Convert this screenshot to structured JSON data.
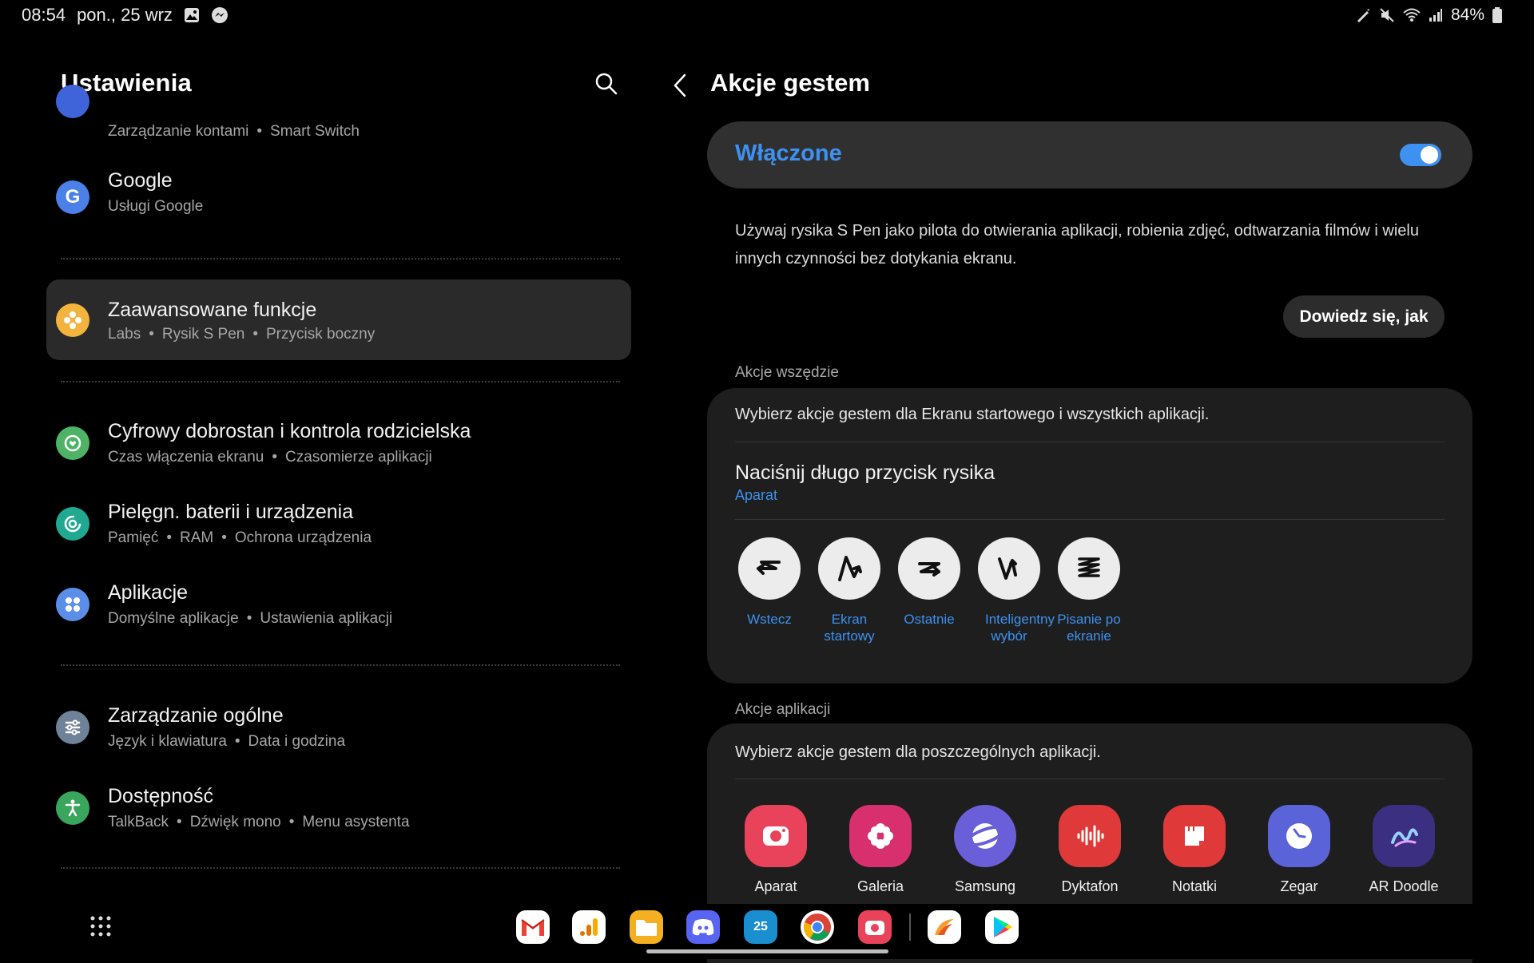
{
  "status_bar": {
    "time": "08:54",
    "date": "pon., 25 wrz",
    "battery": "84%",
    "left_icons": [
      "image-icon",
      "messenger-icon"
    ],
    "right_icons": [
      "spen-icon",
      "mute-icon",
      "wifi-icon",
      "signal-icon",
      "battery-icon"
    ]
  },
  "left_pane": {
    "title": "Ustawienia",
    "items": [
      {
        "title": "",
        "subtitle": [
          "Zarządzanie kontami",
          "Smart Switch"
        ],
        "icon": "accounts-icon",
        "color": "#3f63d9"
      },
      {
        "title": "Google",
        "subtitle": [
          "Usługi Google"
        ],
        "icon": "google-icon",
        "color": "#4a80e8"
      },
      {
        "title": "Zaawansowane funkcje",
        "subtitle": [
          "Labs",
          "Rysik S Pen",
          "Przycisk boczny"
        ],
        "icon": "advanced-features-icon",
        "color": "#f2b43c",
        "selected": true
      },
      {
        "title": "Cyfrowy dobrostan i kontrola rodzicielska",
        "subtitle": [
          "Czas włączenia ekranu",
          "Czasomierze aplikacji"
        ],
        "icon": "wellbeing-icon",
        "color": "#4fb365"
      },
      {
        "title": "Pielęgn. baterii i urządzenia",
        "subtitle": [
          "Pamięć",
          "RAM",
          "Ochrona urządzenia"
        ],
        "icon": "device-care-icon",
        "color": "#21a891"
      },
      {
        "title": "Aplikacje",
        "subtitle": [
          "Domyślne aplikacje",
          "Ustawienia aplikacji"
        ],
        "icon": "apps-icon",
        "color": "#5b8ee8"
      },
      {
        "title": "Zarządzanie ogólne",
        "subtitle": [
          "Język i klawiatura",
          "Data i godzina"
        ],
        "icon": "general-management-icon",
        "color": "#6f8299"
      },
      {
        "title": "Dostępność",
        "subtitle": [
          "TalkBack",
          "Dźwięk mono",
          "Menu asystenta"
        ],
        "icon": "accessibility-icon",
        "color": "#3aa55c"
      }
    ]
  },
  "right_pane": {
    "title": "Akcje gestem",
    "toggle": {
      "label": "Włączone",
      "on": true
    },
    "description": "Używaj rysika S Pen jako pilota do otwierania aplikacji, robienia zdjęć, odtwarzania filmów i wielu innych czynności bez dotykania ekranu.",
    "learn_button": "Dowiedz się, jak",
    "anywhere": {
      "label": "Akcje wszędzie",
      "description": "Wybierz akcje gestem dla Ekranu startowego i wszystkich aplikacji.",
      "press_title": "Naciśnij długo przycisk rysika",
      "press_value": "Aparat",
      "gestures": [
        {
          "label": "Wstecz",
          "icon": "gesture-back-icon"
        },
        {
          "label": "Ekran startowy",
          "icon": "gesture-home-icon"
        },
        {
          "label": "Ostatnie",
          "icon": "gesture-recents-icon"
        },
        {
          "label": "Inteligentny wybór",
          "icon": "gesture-smart-select-icon"
        },
        {
          "label": "Pisanie po ekranie",
          "icon": "gesture-screen-write-icon"
        }
      ]
    },
    "app_actions": {
      "label": "Akcje aplikacji",
      "description": "Wybierz akcje gestem dla poszczególnych aplikacji.",
      "apps": [
        {
          "label": "Aparat",
          "icon": "camera-app-icon",
          "color": "#e8435a"
        },
        {
          "label": "Galeria",
          "icon": "gallery-app-icon",
          "color": "#d8306e"
        },
        {
          "label": "Samsung Internet",
          "icon": "samsung-internet-app-icon",
          "color": "#6a5fd8"
        },
        {
          "label": "Dyktafon",
          "icon": "voice-recorder-app-icon",
          "color": "#e0393a"
        },
        {
          "label": "Notatki Samsung",
          "icon": "samsung-notes-app-icon",
          "color": "#e0393a"
        },
        {
          "label": "Zegar",
          "icon": "clock-app-icon",
          "color": "#5a64d8"
        },
        {
          "label": "AR Doodle",
          "icon": "ar-doodle-app-icon",
          "color": "#3a2f80"
        }
      ]
    }
  },
  "dock": {
    "apps": [
      {
        "name": "gmail-icon",
        "color": "#ffffff"
      },
      {
        "name": "analytics-icon",
        "color": "#ffffff"
      },
      {
        "name": "my-files-icon",
        "color": "#f5b021"
      },
      {
        "name": "discord-icon",
        "color": "#5865f2"
      },
      {
        "name": "calendar-icon",
        "color": "#1a8fd0",
        "text": "25"
      },
      {
        "name": "chrome-icon",
        "color": "#ffffff"
      },
      {
        "name": "camera-dock-icon",
        "color": "#e8435a"
      },
      {
        "name": "swiftkey-icon",
        "color": "#ffffff"
      },
      {
        "name": "play-store-icon",
        "color": "#ffffff"
      }
    ]
  }
}
